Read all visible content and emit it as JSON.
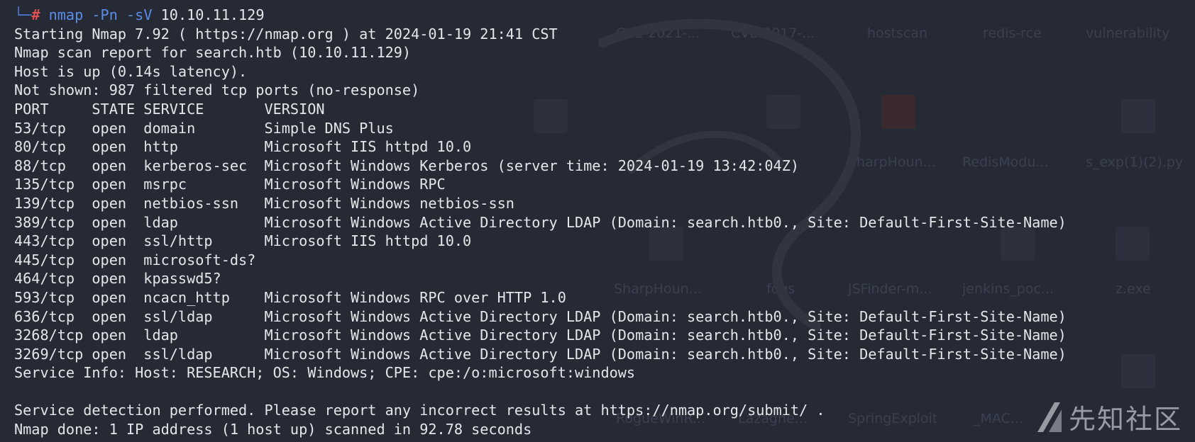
{
  "terminal": {
    "prompt": {
      "corner": "└─",
      "symbol": "#",
      "command": "nmap -Pn -sV",
      "target": "10.10.11.129"
    },
    "lines": [
      "Starting Nmap 7.92 ( https://nmap.org ) at 2024-01-19 21:41 CST",
      "Nmap scan report for search.htb (10.10.11.129)",
      "Host is up (0.14s latency).",
      "Not shown: 987 filtered tcp ports (no-response)",
      "PORT     STATE SERVICE       VERSION",
      "53/tcp   open  domain        Simple DNS Plus",
      "80/tcp   open  http          Microsoft IIS httpd 10.0",
      "88/tcp   open  kerberos-sec  Microsoft Windows Kerberos (server time: 2024-01-19 13:42:04Z)",
      "135/tcp  open  msrpc         Microsoft Windows RPC",
      "139/tcp  open  netbios-ssn   Microsoft Windows netbios-ssn",
      "389/tcp  open  ldap          Microsoft Windows Active Directory LDAP (Domain: search.htb0., Site: Default-First-Site-Name)",
      "443/tcp  open  ssl/http      Microsoft IIS httpd 10.0",
      "445/tcp  open  microsoft-ds?",
      "464/tcp  open  kpasswd5?",
      "593/tcp  open  ncacn_http    Microsoft Windows RPC over HTTP 1.0",
      "636/tcp  open  ssl/ldap      Microsoft Windows Active Directory LDAP (Domain: search.htb0., Site: Default-First-Site-Name)",
      "3268/tcp open  ldap          Microsoft Windows Active Directory LDAP (Domain: search.htb0., Site: Default-First-Site-Name)",
      "3269/tcp open  ssl/ldap      Microsoft Windows Active Directory LDAP (Domain: search.htb0., Site: Default-First-Site-Name)",
      "Service Info: Host: RESEARCH; OS: Windows; CPE: cpe:/o:microsoft:windows",
      "",
      "Service detection performed. Please report any incorrect results at https://nmap.org/submit/ .",
      "Nmap done: 1 IP address (1 host up) scanned in 92.78 seconds"
    ]
  },
  "desktop": {
    "labels": [
      "CVE-2021-...",
      "CVE-2017-...",
      "hostscan",
      "redis-rce",
      "vulnerability",
      "SharpHoun...",
      "RedisModu...",
      "s_exp(1)(2).py",
      "SharpHoun...",
      "fogs",
      "JSFinder-m...",
      "jenkins_poc...",
      "z.exe",
      "RogueWinR...",
      "Lazagne...",
      "SpringExploit",
      "_MAC..."
    ]
  },
  "watermark": {
    "text": "先知社区",
    "icon": "xianzhi-logo-icon"
  },
  "colors": {
    "background": "#262a35",
    "text": "#e4e6ea",
    "prompt_accent": "#5b8ce8",
    "prompt_symbol": "#e05050"
  }
}
